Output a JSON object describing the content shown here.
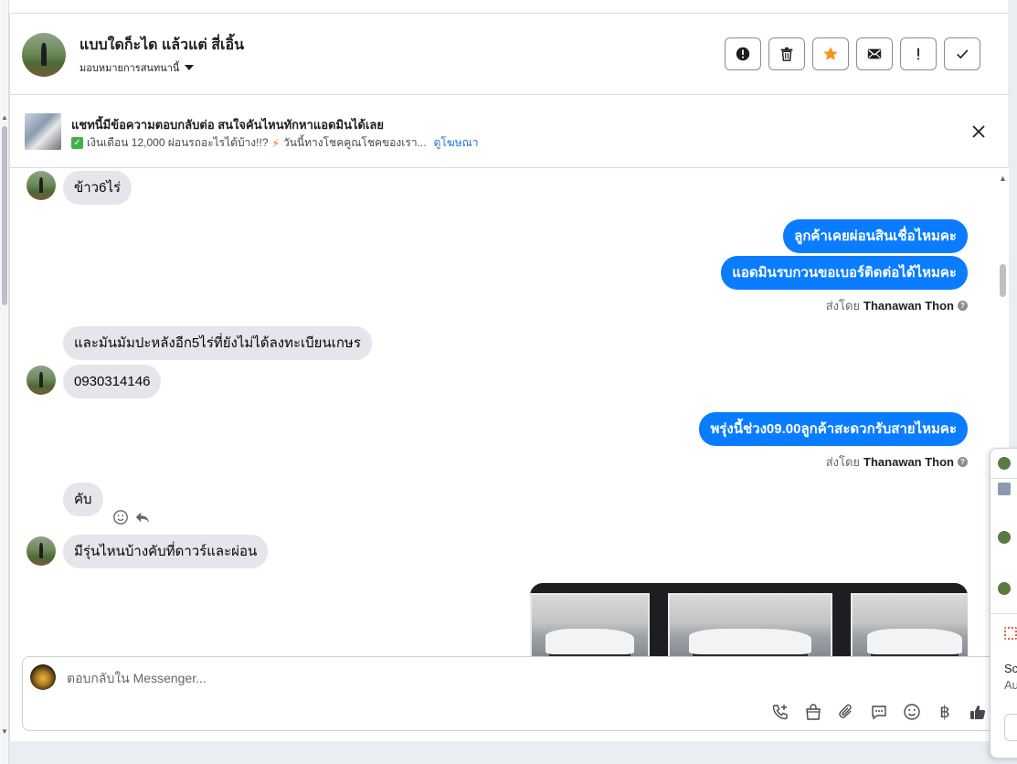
{
  "header": {
    "contact_name": "แบบใดก็ะได แล้วแต่ สี่เอิ้น",
    "assign_label": "มอบหมายการสนทนานี้",
    "actions": [
      {
        "name": "mark-spam-button",
        "icon": "exclamation-circle-icon"
      },
      {
        "name": "delete-button",
        "icon": "trash-icon"
      },
      {
        "name": "star-button",
        "icon": "star-icon"
      },
      {
        "name": "mark-unread-button",
        "icon": "envelope-icon"
      },
      {
        "name": "follow-up-button",
        "icon": "exclamation-icon"
      },
      {
        "name": "mark-done-button",
        "icon": "checkmark-icon"
      }
    ],
    "star_color": "#f7931e"
  },
  "banner": {
    "title": "แชทนี้มีข้อความตอบกลับต่อ สนใจคันไหนทักหาแอดมินได้เลย",
    "subtitle_part1": "เงินเดือน 12,000 ผ่อนรถอะไรได้บ้าง!!?",
    "subtitle_part2": "วันนี้ทางโชคคูณโชคของเรา...",
    "link": "ดูโฆษณา"
  },
  "messages": {
    "m1": "ข้าว6ไร่",
    "m2": "ลูกค้าเคยผ่อนสินเชื่อไหมคะ",
    "m3": "แอดมินรบกวนขอเบอร์ติดต่อได้ไหมคะ",
    "sent_by_prefix": "ส่งโดย",
    "sent_by_name": "Thanawan Thon",
    "m4": "และมันมัมปะหลังอีก5ไร่ที่ยังไม่ได้ลงทะเบียนเกษร",
    "m5": "0930314146",
    "m6": "พรุ่งนี้ช่วง09.00ลูกค้าสะดวกรับสายไหมคะ",
    "m7": "คับ",
    "m8": "มีรุ่นไหนบ้างคับที่ดาวร์และผ่อน"
  },
  "composer": {
    "placeholder": "ตอบกลับใน Messenger...",
    "tools": [
      "call-add-icon",
      "shopping-bag-icon",
      "paperclip-icon",
      "chat-bubble-icon",
      "emoji-icon",
      "baht-icon",
      "thumbs-up-icon"
    ],
    "baht_symbol": "฿"
  },
  "popup": {
    "line1": "Sc",
    "line2": "Au"
  },
  "colors": {
    "outgoing_bubble": "#0a7cff",
    "incoming_bubble": "#e4e6eb",
    "link": "#1b74e4"
  }
}
